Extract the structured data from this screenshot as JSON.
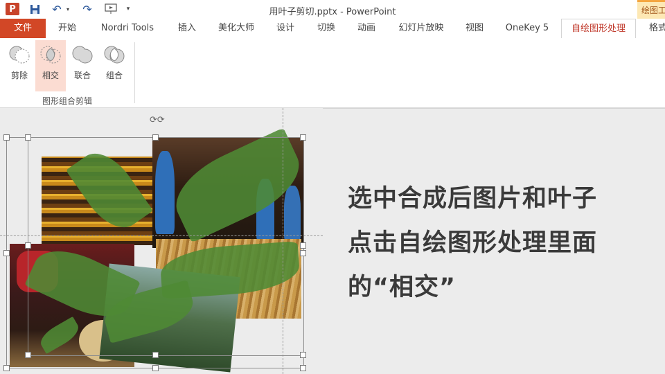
{
  "window": {
    "title": "用叶子剪切.pptx - PowerPoint",
    "context_tab_title": "绘图工"
  },
  "quick_access": {
    "app_logo": "P"
  },
  "tabs": [
    {
      "label": "文件"
    },
    {
      "label": "开始"
    },
    {
      "label": "Nordri Tools"
    },
    {
      "label": "插入"
    },
    {
      "label": "美化大师"
    },
    {
      "label": "设计"
    },
    {
      "label": "切换"
    },
    {
      "label": "动画"
    },
    {
      "label": "幻灯片放映"
    },
    {
      "label": "视图"
    },
    {
      "label": "OneKey 5"
    },
    {
      "label": "自绘图形处理"
    },
    {
      "label": "格式"
    }
  ],
  "ribbon": {
    "buttons": [
      {
        "label": "剪除",
        "icon": "shape-subtract-icon"
      },
      {
        "label": "相交",
        "icon": "shape-intersect-icon",
        "selected": true
      },
      {
        "label": "联合",
        "icon": "shape-union-icon"
      },
      {
        "label": "组合",
        "icon": "shape-combine-icon"
      }
    ],
    "group_label": "图形组合剪辑"
  },
  "slide": {
    "caption_lines": [
      "选中合成后图片和叶子",
      "点击自绘图形处理里面",
      "的“相交”"
    ]
  },
  "colors": {
    "file_tab": "#d24726",
    "active_tab_text": "#c0392b",
    "selected_button": "#fbdcd2",
    "leaf_green": "#4f8a34"
  }
}
